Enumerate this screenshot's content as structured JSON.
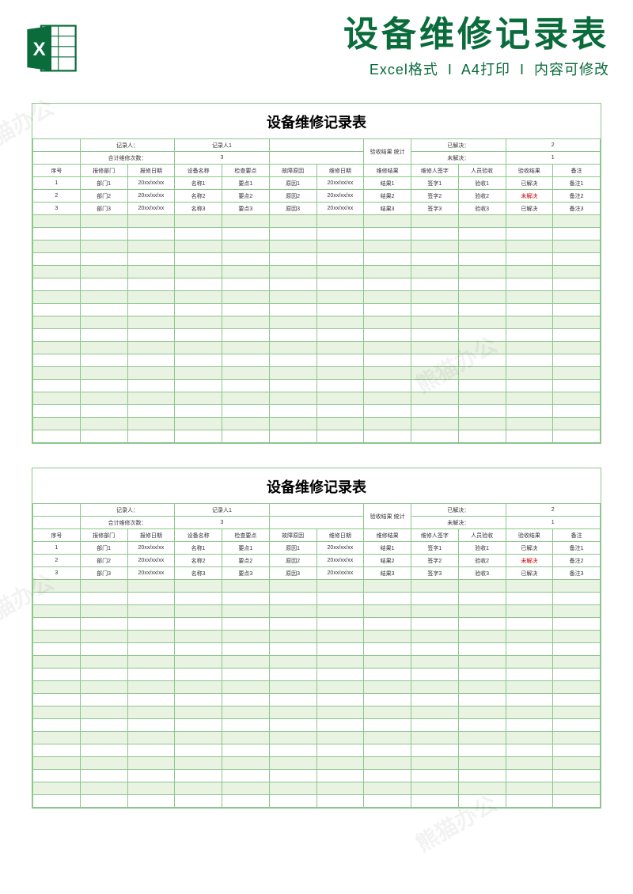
{
  "watermark": "熊猫办公",
  "header": {
    "title": "设备维修记录表",
    "sub1": "Excel格式",
    "sub2": "A4打印",
    "sub3": "内容可修改"
  },
  "sheet": {
    "title": "设备维修记录表",
    "info": {
      "recorder_label": "记录人：",
      "recorder_value": "记录人1",
      "stat_label": "验收结果 统计",
      "solved_label": "已解决：",
      "solved_value": "2",
      "total_label": "合计维修次数：",
      "total_value": "3",
      "unsolved_label": "未解决：",
      "unsolved_value": "1"
    },
    "columns": [
      "序号",
      "报修部门",
      "报修日期",
      "设备名称",
      "检查要点",
      "故障原因",
      "维修日期",
      "维修结果",
      "维修人签字",
      "人员验收",
      "验收结果",
      "备注"
    ],
    "rows": [
      {
        "seq": "1",
        "dept": "部门1",
        "rdate": "20xx/xx/xx",
        "dev": "名称1",
        "check": "要点1",
        "fault": "原因1",
        "mdate": "20xx/xx/xx",
        "res": "结果1",
        "sign": "签字1",
        "accept": "验收1",
        "status": "已解决",
        "status_red": false,
        "note": "备注1"
      },
      {
        "seq": "2",
        "dept": "部门2",
        "rdate": "20xx/xx/xx",
        "dev": "名称2",
        "check": "要点2",
        "fault": "原因2",
        "mdate": "20xx/xx/xx",
        "res": "结果2",
        "sign": "签字2",
        "accept": "验收2",
        "status": "未解决",
        "status_red": true,
        "note": "备注2"
      },
      {
        "seq": "3",
        "dept": "部门3",
        "rdate": "20xx/xx/xx",
        "dev": "名称3",
        "check": "要点3",
        "fault": "原因3",
        "mdate": "20xx/xx/xx",
        "res": "结果3",
        "sign": "签字3",
        "accept": "验收3",
        "status": "已解决",
        "status_red": false,
        "note": "备注3"
      }
    ],
    "empty_rows": 18
  }
}
